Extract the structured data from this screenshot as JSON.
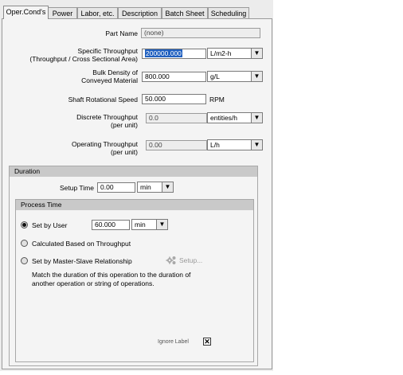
{
  "tabs": [
    {
      "label": "Oper.Cond's",
      "active": true
    },
    {
      "label": "Power",
      "active": false
    },
    {
      "label": "Labor, etc.",
      "active": false
    },
    {
      "label": "Description",
      "active": false
    },
    {
      "label": "Batch Sheet",
      "active": false
    },
    {
      "label": "Scheduling",
      "active": false
    }
  ],
  "part_name": {
    "label": "Part Name",
    "value": "(none)"
  },
  "specific_throughput": {
    "label_line1": "Specific Throughput",
    "label_line2": "(Throughput / Cross Sectional Area)",
    "value": "200000.000",
    "unit": "L/m2-h"
  },
  "bulk_density": {
    "label_line1": "Bulk Density of",
    "label_line2": "Conveyed Material",
    "value": "800.000",
    "unit": "g/L"
  },
  "shaft_speed": {
    "label": "Shaft Rotational Speed",
    "value": "50.000",
    "unit": "RPM"
  },
  "discrete_throughput": {
    "label_line1": "Discrete Throughput",
    "label_line2": "(per unit)",
    "value": "0.0",
    "unit": "entities/h"
  },
  "operating_throughput": {
    "label_line1": "Operating Throughput",
    "label_line2": "(per unit)",
    "value": "0.00",
    "unit": "L/h"
  },
  "duration": {
    "header": "Duration",
    "setup_time": {
      "label": "Setup Time",
      "value": "0.00",
      "unit": "min"
    },
    "process_time": {
      "header": "Process Time",
      "set_by_user": {
        "label": "Set by User",
        "value": "60.000",
        "unit": "min",
        "selected": true
      },
      "calculated": {
        "label": "Calculated Based on Throughput",
        "selected": false
      },
      "master_slave": {
        "label": "Set by Master-Slave Relationship",
        "selected": false
      },
      "setup_button": "Setup...",
      "description": "Match the duration of this operation to the duration of another operation or string of operations."
    }
  },
  "ignore_label": "Ignore Label",
  "ignore_checked": true,
  "icons": {
    "dropdown": "down-arrow-icon",
    "setup": "gear-icon"
  }
}
